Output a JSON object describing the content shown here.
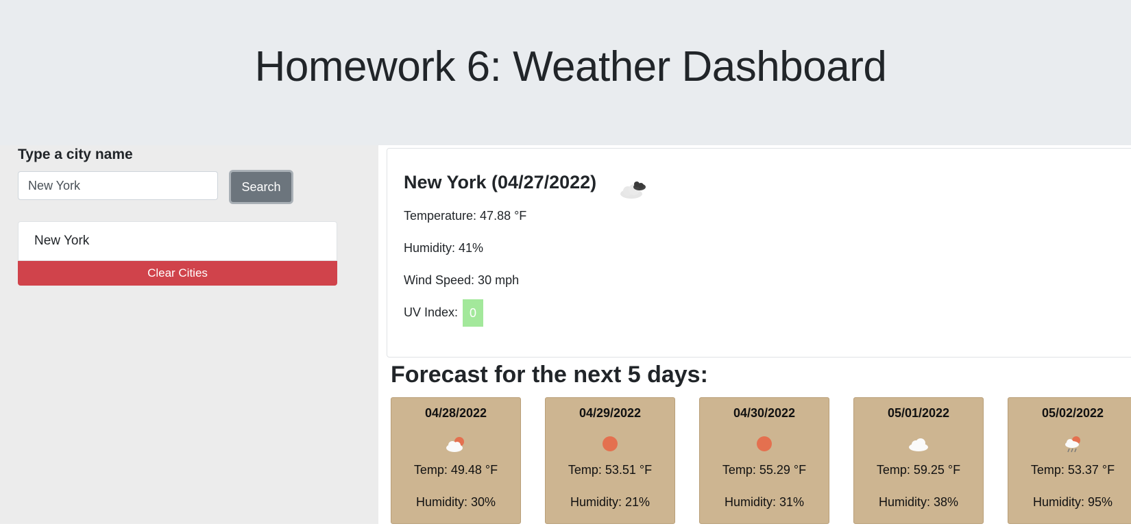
{
  "header": {
    "title": "Homework 6: Weather Dashboard"
  },
  "sidebar": {
    "label": "Type a city name",
    "search_value": "New York",
    "search_button": "Search",
    "cities": [
      "New York"
    ],
    "clear_button": "Clear Cities"
  },
  "current": {
    "heading": "New York (04/27/2022)",
    "icon": "broken-clouds-icon",
    "temperature": "Temperature: 47.88 °F",
    "humidity": "Humidity: 41%",
    "wind": "Wind Speed: 30 mph",
    "uv_label": "UV Index:",
    "uv_value": "0",
    "uv_color": "#a3e89b"
  },
  "forecast": {
    "title": "Forecast for the next 5 days:",
    "days": [
      {
        "date": "04/28/2022",
        "icon": "partly-cloudy-icon",
        "temp": "Temp: 49.48 °F",
        "humidity": "Humidity: 30%"
      },
      {
        "date": "04/29/2022",
        "icon": "sun-icon",
        "temp": "Temp: 53.51 °F",
        "humidity": "Humidity: 21%"
      },
      {
        "date": "04/30/2022",
        "icon": "sun-icon",
        "temp": "Temp: 55.29 °F",
        "humidity": "Humidity: 31%"
      },
      {
        "date": "05/01/2022",
        "icon": "cloud-icon",
        "temp": "Temp: 59.25 °F",
        "humidity": "Humidity: 38%"
      },
      {
        "date": "05/02/2022",
        "icon": "rain-sun-icon",
        "temp": "Temp: 53.37 °F",
        "humidity": "Humidity: 95%"
      }
    ]
  },
  "colors": {
    "card": "#cdb591",
    "clear_button": "#d0434b",
    "search_button": "#6c757d",
    "sun": "#e4704f"
  }
}
